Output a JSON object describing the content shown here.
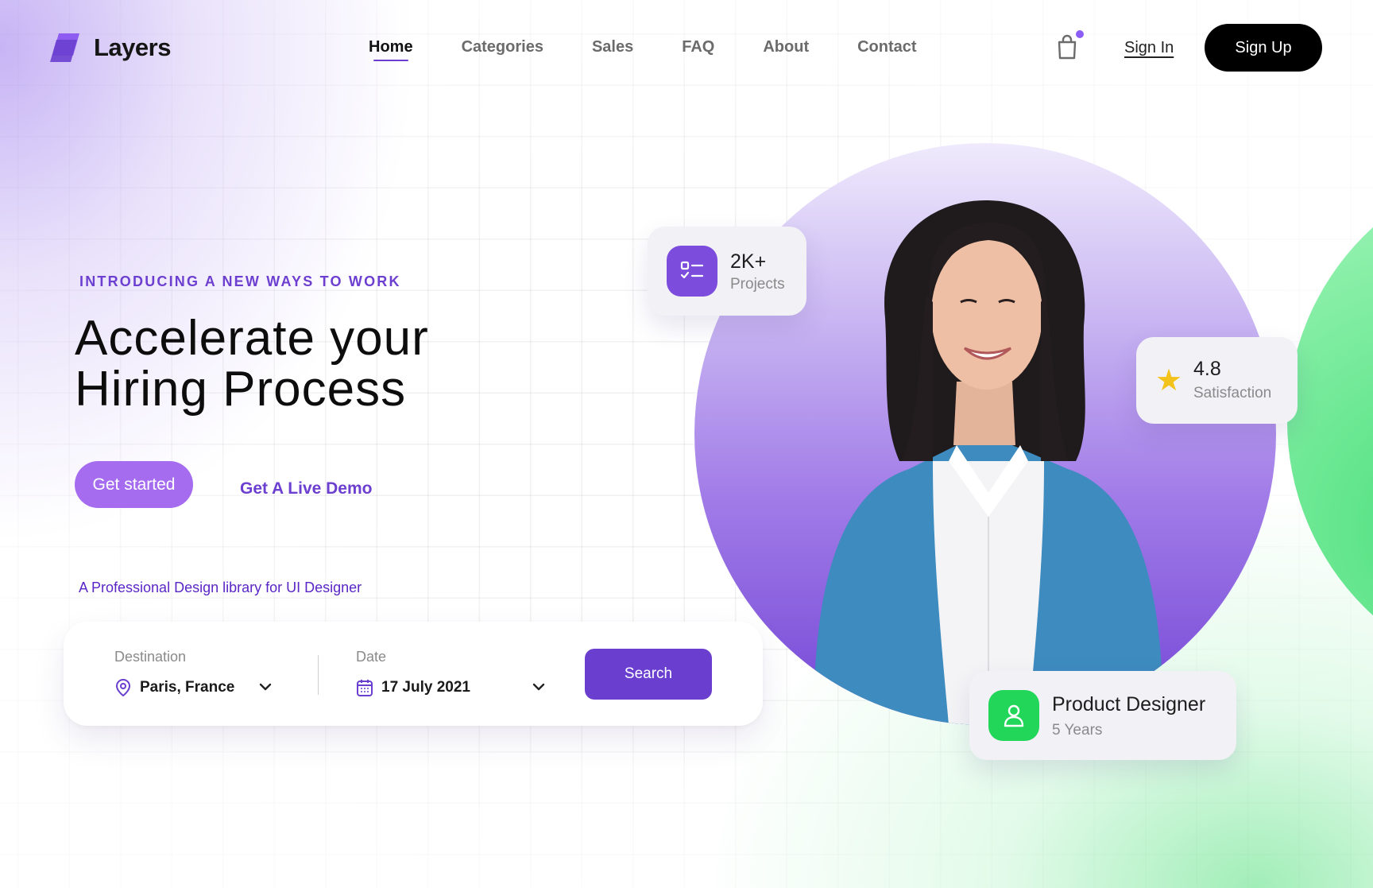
{
  "brand": {
    "name": "Layers",
    "accent": "#6a3fcf"
  },
  "nav": {
    "items": [
      {
        "label": "Home",
        "active": true
      },
      {
        "label": "Categories",
        "active": false
      },
      {
        "label": "Sales",
        "active": false
      },
      {
        "label": "FAQ",
        "active": false
      },
      {
        "label": "About",
        "active": false
      },
      {
        "label": "Contact",
        "active": false
      }
    ],
    "cart_icon": "shopping-bag-icon",
    "sign_in": "Sign In",
    "sign_up": "Sign Up"
  },
  "hero": {
    "eyebrow": "INTRODUCING A NEW WAYS TO WORK",
    "headline_line1": "Accelerate your",
    "headline_line2": "Hiring Process",
    "primary_cta": "Get started",
    "secondary_cta": "Get A Live Demo",
    "tagline": "A Professional Design library for UI Designer"
  },
  "search": {
    "destination_label": "Destination",
    "destination_value": "Paris, France",
    "date_label": "Date",
    "date_value": "17 July 2021",
    "button": "Search"
  },
  "stats": {
    "projects_value": "2K+",
    "projects_label": "Projects",
    "rating_value": "4.8",
    "rating_label": "Satisfaction",
    "role_title": "Product Designer",
    "role_years": "5 Years"
  }
}
